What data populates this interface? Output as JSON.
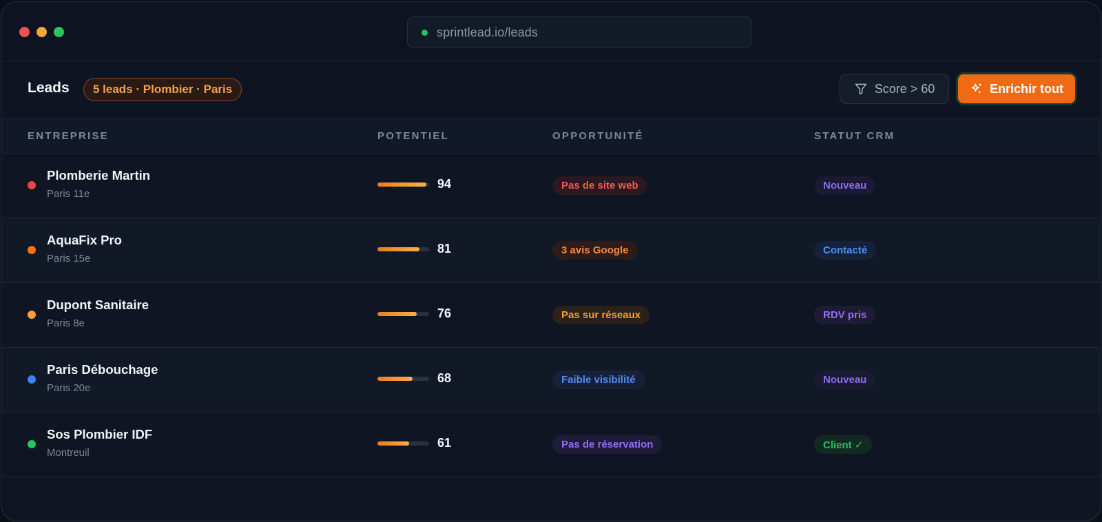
{
  "browser": {
    "url": "sprintlead.io/leads"
  },
  "toolbar": {
    "title": "Leads",
    "count_badge": "5 leads · Plombier · Paris",
    "filter_label": "Score > 60",
    "enrich_label": "Enrichir tout"
  },
  "table": {
    "headers": {
      "company": "ENTREPRISE",
      "potential": "POTENTIEL",
      "opportunity": "OPPORTUNITÉ",
      "crm": "STATUT CRM"
    },
    "rows": [
      {
        "name": "Plomberie Martin",
        "location": "Paris 11e",
        "dot_color": "#ef4444",
        "score": 94,
        "opportunity": "Pas de site web",
        "opp_color": "#ef5b4c",
        "opp_bg": "#2b1820",
        "crm": "Nouveau",
        "crm_color": "#8b6cf0",
        "crm_bg": "#1b1a33"
      },
      {
        "name": "AquaFix Pro",
        "location": "Paris 15e",
        "dot_color": "#f97316",
        "score": 81,
        "opportunity": "3 avis Google",
        "opp_color": "#f7893a",
        "opp_bg": "#2b1c1a",
        "crm": "Contacté",
        "crm_color": "#4f8ff0",
        "crm_bg": "#16213a"
      },
      {
        "name": "Dupont Sanitaire",
        "location": "Paris 8e",
        "dot_color": "#f6a03c",
        "score": 76,
        "opportunity": "Pas sur réseaux",
        "opp_color": "#f5a03a",
        "opp_bg": "#2b2118",
        "crm": "RDV pris",
        "crm_color": "#9370f2",
        "crm_bg": "#1d1b35"
      },
      {
        "name": "Paris Débouchage",
        "location": "Paris 20e",
        "dot_color": "#3b82f6",
        "score": 68,
        "opportunity": "Faible visibilité",
        "opp_color": "#4d8cf2",
        "opp_bg": "#162038",
        "crm": "Nouveau",
        "crm_color": "#8b6cf0",
        "crm_bg": "#1b1a33"
      },
      {
        "name": "Sos Plombier IDF",
        "location": "Montreuil",
        "dot_color": "#22c55e",
        "score": 61,
        "opportunity": "Pas de réservation",
        "opp_color": "#8f6ef2",
        "opp_bg": "#1e1c38",
        "crm": "Client ✓",
        "crm_color": "#2cc065",
        "crm_bg": "#132a22"
      }
    ]
  },
  "icons": {
    "filter": "filter-icon",
    "enrich": "sparkles-icon"
  }
}
